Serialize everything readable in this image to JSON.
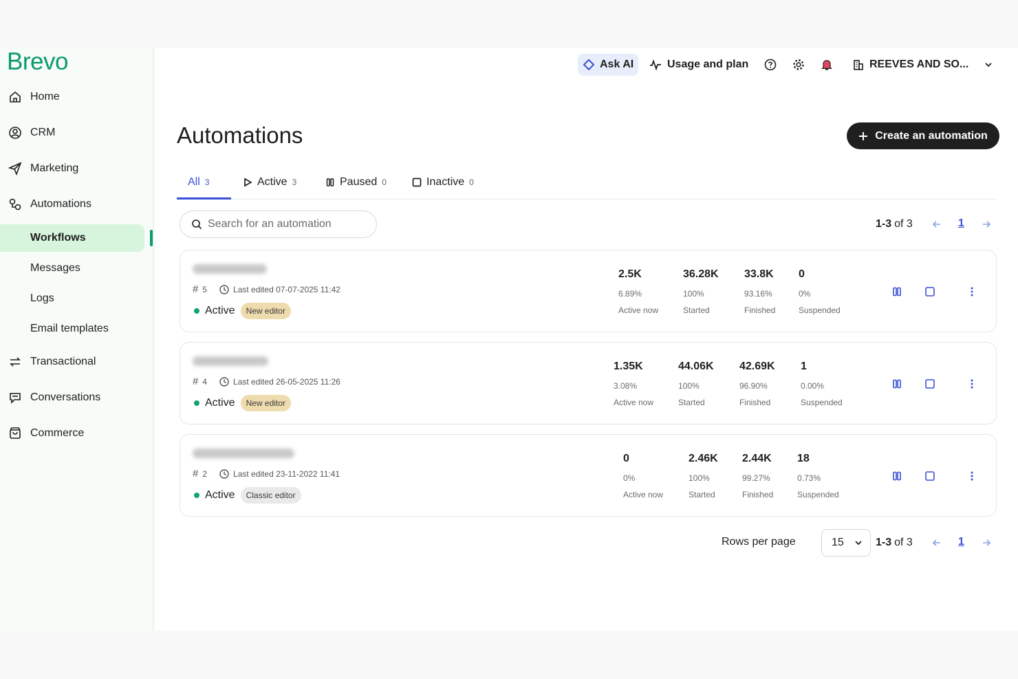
{
  "sidebar": {
    "logo": "Brevo",
    "items": [
      {
        "label": "Home",
        "icon": "home-icon"
      },
      {
        "label": "CRM",
        "icon": "contacts-icon"
      },
      {
        "label": "Marketing",
        "icon": "send-icon"
      },
      {
        "label": "Automations",
        "icon": "automation-icon"
      },
      {
        "label": "Workflows"
      },
      {
        "label": "Messages"
      },
      {
        "label": "Logs"
      },
      {
        "label": "Email templates"
      },
      {
        "label": "Transactional",
        "icon": "transfer-icon"
      },
      {
        "label": "Conversations",
        "icon": "chat-icon"
      },
      {
        "label": "Commerce",
        "icon": "bag-icon"
      }
    ],
    "accent": "#0b996e"
  },
  "topbar": {
    "ask_ai": "Ask AI",
    "usage": "Usage and plan",
    "company": "REEVES AND SO..."
  },
  "main": {
    "title": "Automations",
    "create_button": "Create an automation",
    "tabs": [
      {
        "label": "All",
        "count": "3"
      },
      {
        "label": "Active",
        "count": "3"
      },
      {
        "label": "Paused",
        "count": "0"
      },
      {
        "label": "Inactive",
        "count": "0"
      }
    ],
    "search_placeholder": "Search for an automation",
    "pager": {
      "range": "1-3",
      "of": "of 3",
      "page": "1"
    },
    "rows_per_page_label": "Rows per page",
    "rows_per_page_value": "15"
  },
  "automations": [
    {
      "id": "5",
      "last_edited": "Last edited 07-07-2025 11:42",
      "status": "Active",
      "editor": "New editor",
      "stats": [
        {
          "value": "2.5K",
          "pct": "6.89%",
          "label": "Active now"
        },
        {
          "value": "36.28K",
          "pct": "100%",
          "label": "Started"
        },
        {
          "value": "33.8K",
          "pct": "93.16%",
          "label": "Finished"
        },
        {
          "value": "0",
          "pct": "0%",
          "label": "Suspended"
        }
      ]
    },
    {
      "id": "4",
      "last_edited": "Last edited 26-05-2025 11:26",
      "status": "Active",
      "editor": "New editor",
      "stats": [
        {
          "value": "1.35K",
          "pct": "3.08%",
          "label": "Active now"
        },
        {
          "value": "44.06K",
          "pct": "100%",
          "label": "Started"
        },
        {
          "value": "42.69K",
          "pct": "96.90%",
          "label": "Finished"
        },
        {
          "value": "1",
          "pct": "0.00%",
          "label": "Suspended"
        }
      ]
    },
    {
      "id": "2",
      "last_edited": "Last edited 23-11-2022 11:41",
      "status": "Active",
      "editor": "Classic editor",
      "stats": [
        {
          "value": "0",
          "pct": "0%",
          "label": "Active now"
        },
        {
          "value": "2.46K",
          "pct": "100%",
          "label": "Started"
        },
        {
          "value": "2.44K",
          "pct": "99.27%",
          "label": "Finished"
        },
        {
          "value": "18",
          "pct": "0.73%",
          "label": "Suspended"
        }
      ]
    }
  ]
}
